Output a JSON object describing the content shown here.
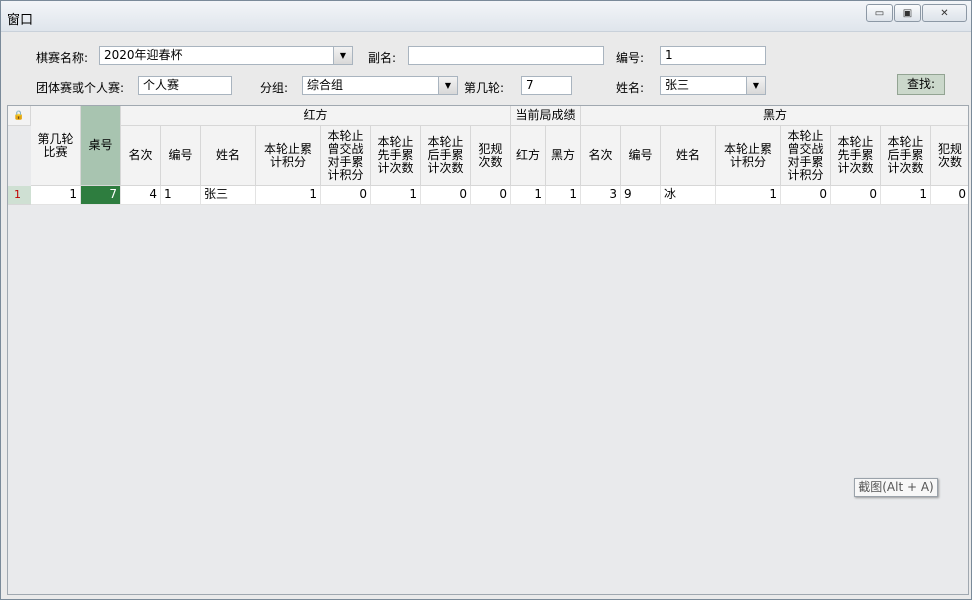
{
  "window": {
    "title": "窗口",
    "min_glyph": "▭",
    "max_glyph": "▣",
    "close_glyph": "✕"
  },
  "form": {
    "event_name_label": "棋赛名称:",
    "event_name_value": "2020年迎春杯",
    "subtitle_label": "副名:",
    "subtitle_value": "",
    "number_label": "编号:",
    "number_value": "1",
    "type_label": "团体赛或个人赛:",
    "type_value": "个人赛",
    "group_label": "分组:",
    "group_value": "综合组",
    "round_label": "第几轮:",
    "round_value": "7",
    "name_label": "姓名:",
    "name_value": "张三",
    "search_label": "查找:"
  },
  "grid": {
    "lock_icon": "🔒",
    "groups": {
      "red": "红方",
      "current": "当前局成绩",
      "black": "黑方"
    },
    "headers": {
      "round": "第几轮比赛",
      "table": "桌号",
      "red_rank": "名次",
      "red_no": "编号",
      "red_name": "姓名",
      "red_total": "本轮止累计积分",
      "red_opp": "本轮止曾交战对手累计积分",
      "red_first": "本轮止先手累计次数",
      "red_second": "本轮止后手累计次数",
      "red_foul": "犯规次数",
      "cur_red": "红方",
      "cur_black": "黑方",
      "blk_rank": "名次",
      "blk_no": "编号",
      "blk_name": "姓名",
      "blk_total": "本轮止累计积分",
      "blk_opp": "本轮止曾交战对手累计积分",
      "blk_first": "本轮止先手累计次数",
      "blk_second": "本轮止后手累计次数",
      "blk_foul": "犯规次数"
    },
    "rows": [
      {
        "row_no": "1",
        "round": "1",
        "table": "7",
        "red_rank": "4",
        "red_no": "1",
        "red_name": "张三",
        "red_total": "1",
        "red_opp": "0",
        "red_first": "1",
        "red_second": "0",
        "red_foul": "0",
        "cur_red": "1",
        "cur_black": "1",
        "blk_rank": "3",
        "blk_no": "9",
        "blk_name": "冰",
        "blk_total": "1",
        "blk_opp": "0",
        "blk_first": "0",
        "blk_second": "1",
        "blk_foul": "0"
      }
    ]
  },
  "tooltip": {
    "text": "截图(Alt + A)"
  },
  "colors": {
    "active_cell": "#2e7d3f",
    "selected_header": "#a8c4b0",
    "row_number": "#c00000"
  }
}
